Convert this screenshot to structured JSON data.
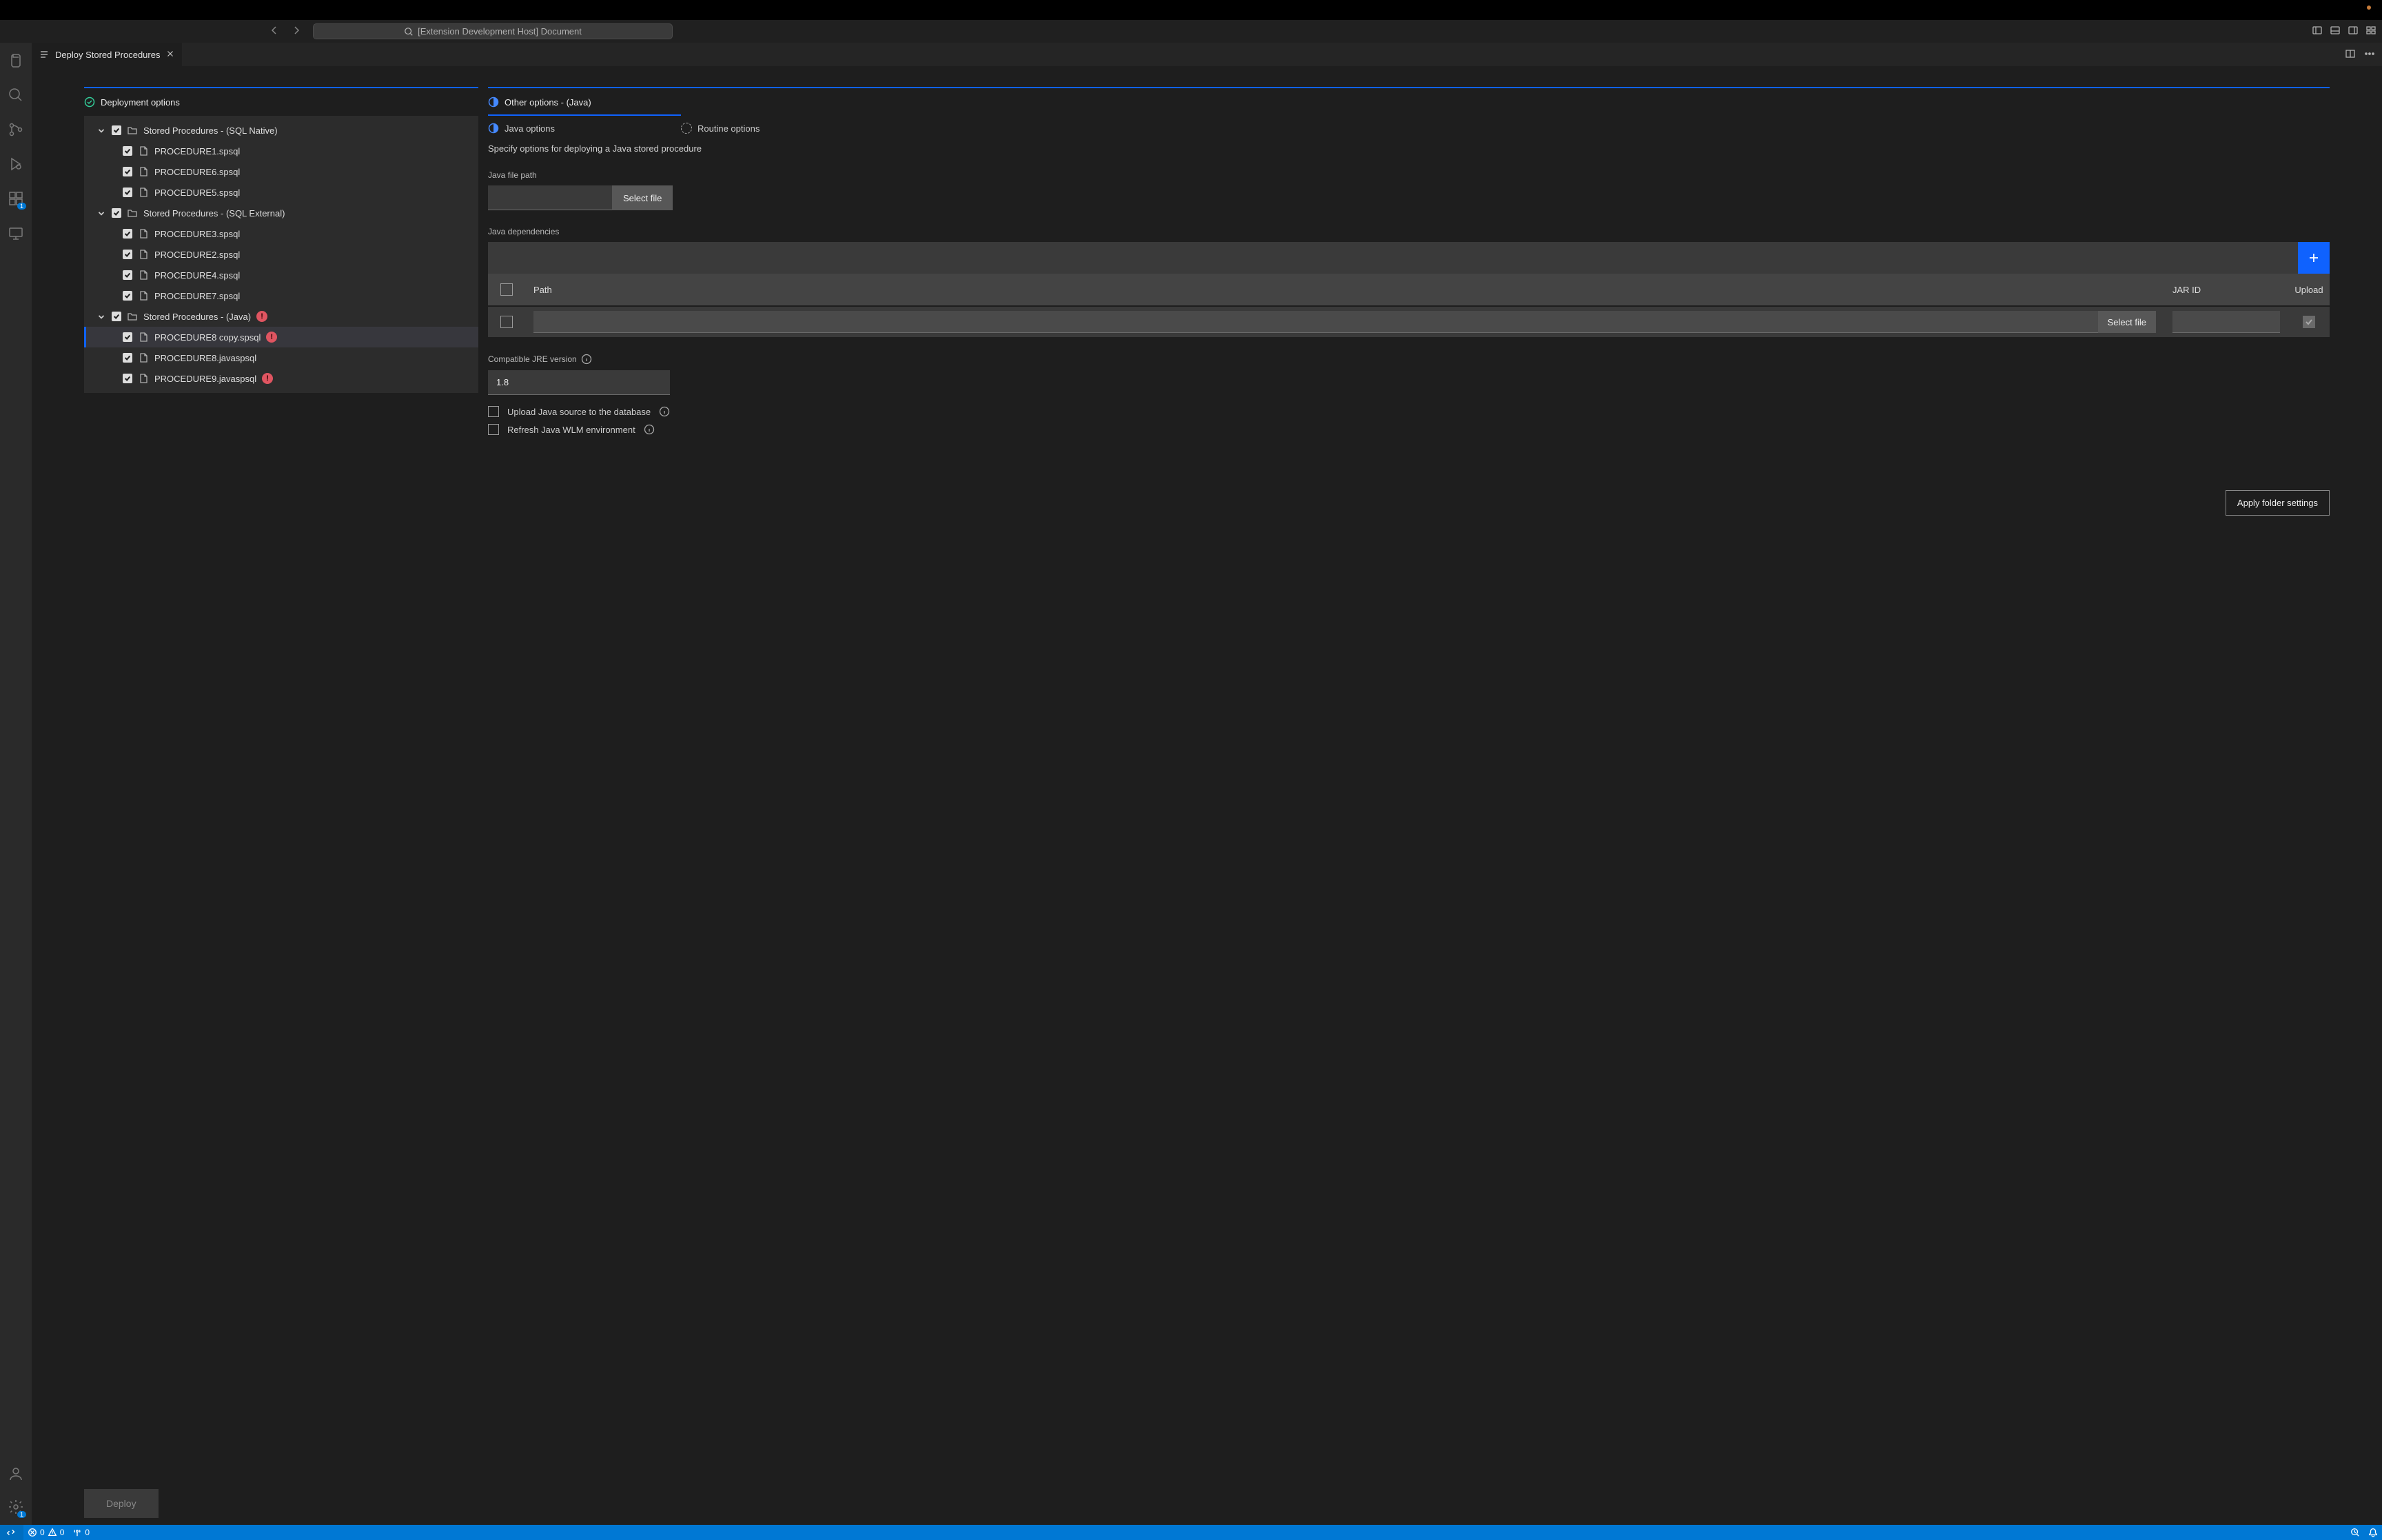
{
  "titlebar": {
    "search_placeholder": "[Extension Development Host] Document"
  },
  "tab": {
    "title": "Deploy Stored Procedures"
  },
  "activitybar": {
    "extensions_badge": "1",
    "settings_badge": "1"
  },
  "left": {
    "header": "Deployment options",
    "deploy_button": "Deploy",
    "groups": [
      {
        "name": "Stored Procedures - (SQL Native)",
        "error": false,
        "items": [
          {
            "name": "PROCEDURE1.spsql",
            "error": false
          },
          {
            "name": "PROCEDURE6.spsql",
            "error": false
          },
          {
            "name": "PROCEDURE5.spsql",
            "error": false
          }
        ]
      },
      {
        "name": "Stored Procedures - (SQL External)",
        "error": false,
        "items": [
          {
            "name": "PROCEDURE3.spsql",
            "error": false
          },
          {
            "name": "PROCEDURE2.spsql",
            "error": false
          },
          {
            "name": "PROCEDURE4.spsql",
            "error": false
          },
          {
            "name": "PROCEDURE7.spsql",
            "error": false
          }
        ]
      },
      {
        "name": "Stored Procedures - (Java)",
        "error": true,
        "items": [
          {
            "name": "PROCEDURE8 copy.spsql",
            "error": true,
            "selected": true
          },
          {
            "name": "PROCEDURE8.javaspsql",
            "error": false
          },
          {
            "name": "PROCEDURE9.javaspsql",
            "error": true
          }
        ]
      }
    ]
  },
  "right": {
    "header": "Other options - (Java)",
    "subtab_java": "Java options",
    "subtab_routine": "Routine options",
    "description": "Specify options for deploying a Java stored procedure",
    "java_file_path_label": "Java file path",
    "select_file_btn": "Select file",
    "java_deps_label": "Java dependencies",
    "table": {
      "col_path": "Path",
      "col_jarid": "JAR ID",
      "col_upload": "Upload",
      "row_select_file": "Select file"
    },
    "jre_label": "Compatible JRE version",
    "jre_value": "1.8",
    "upload_source_label": "Upload Java source to the database",
    "refresh_wlm_label": "Refresh Java WLM environment",
    "apply_btn": "Apply folder settings"
  },
  "statusbar": {
    "errors": "0",
    "warnings": "0",
    "ports": "0"
  }
}
